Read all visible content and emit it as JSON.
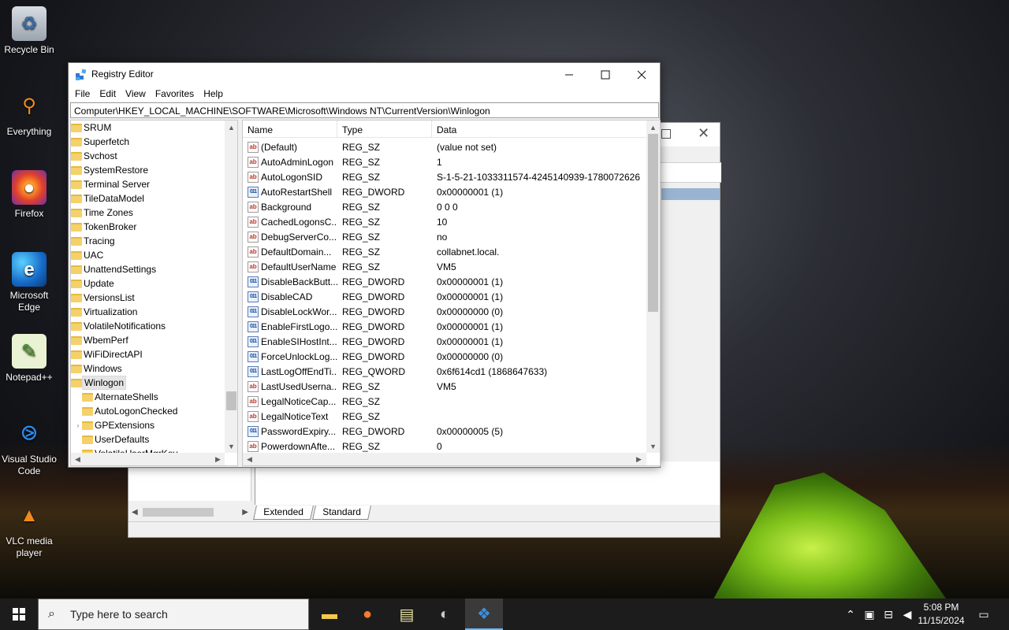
{
  "desktop": {
    "icons": [
      {
        "label": "Recycle Bin",
        "icon": "recycle-bin-icon"
      },
      {
        "label": "Everything",
        "icon": "everything-icon"
      },
      {
        "label": "Firefox",
        "icon": "firefox-icon"
      },
      {
        "label": "Microsoft Edge",
        "icon": "edge-icon"
      },
      {
        "label": "Notepad++",
        "icon": "notepadpp-icon"
      },
      {
        "label": "Visual Studio Code",
        "icon": "vscode-icon"
      },
      {
        "label": "VLC media player",
        "icon": "vlc-icon"
      }
    ]
  },
  "back_window": {
    "tabs": [
      "Extended",
      "Standard"
    ]
  },
  "registry": {
    "title": "Registry Editor",
    "menu": [
      "File",
      "Edit",
      "View",
      "Favorites",
      "Help"
    ],
    "address": "Computer\\HKEY_LOCAL_MACHINE\\SOFTWARE\\Microsoft\\Windows NT\\CurrentVersion\\Winlogon",
    "tree": [
      "SRUM",
      "Superfetch",
      "Svchost",
      "SystemRestore",
      "Terminal Server",
      "TileDataModel",
      "Time Zones",
      "TokenBroker",
      "Tracing",
      "UAC",
      "UnattendSettings",
      "Update",
      "VersionsList",
      "Virtualization",
      "VolatileNotifications",
      "WbemPerf",
      "WiFiDirectAPI",
      "Windows",
      "Winlogon"
    ],
    "tree_children": [
      "AlternateShells",
      "AutoLogonChecked",
      "GPExtensions",
      "UserDefaults",
      "VolatileUserMgrKey"
    ],
    "columns": {
      "name": "Name",
      "type": "Type",
      "data": "Data"
    },
    "values": [
      {
        "name": "(Default)",
        "type": "REG_SZ",
        "data": "(value not set)"
      },
      {
        "name": "AutoAdminLogon",
        "type": "REG_SZ",
        "data": "1"
      },
      {
        "name": "AutoLogonSID",
        "type": "REG_SZ",
        "data": "S-1-5-21-1033311574-4245140939-1780072626"
      },
      {
        "name": "AutoRestartShell",
        "type": "REG_DWORD",
        "data": "0x00000001 (1)"
      },
      {
        "name": "Background",
        "type": "REG_SZ",
        "data": "0 0 0"
      },
      {
        "name": "CachedLogonsC...",
        "type": "REG_SZ",
        "data": "10"
      },
      {
        "name": "DebugServerCo...",
        "type": "REG_SZ",
        "data": "no"
      },
      {
        "name": "DefaultDomain...",
        "type": "REG_SZ",
        "data": "collabnet.local."
      },
      {
        "name": "DefaultUserName",
        "type": "REG_SZ",
        "data": "VM5"
      },
      {
        "name": "DisableBackButt...",
        "type": "REG_DWORD",
        "data": "0x00000001 (1)"
      },
      {
        "name": "DisableCAD",
        "type": "REG_DWORD",
        "data": "0x00000001 (1)"
      },
      {
        "name": "DisableLockWor...",
        "type": "REG_DWORD",
        "data": "0x00000000 (0)"
      },
      {
        "name": "EnableFirstLogo...",
        "type": "REG_DWORD",
        "data": "0x00000001 (1)"
      },
      {
        "name": "EnableSIHostInt...",
        "type": "REG_DWORD",
        "data": "0x00000001 (1)"
      },
      {
        "name": "ForceUnlockLog...",
        "type": "REG_DWORD",
        "data": "0x00000000 (0)"
      },
      {
        "name": "LastLogOffEndTi...",
        "type": "REG_QWORD",
        "data": "0x6f614cd1 (1868647633)"
      },
      {
        "name": "LastUsedUserna...",
        "type": "REG_SZ",
        "data": "VM5"
      },
      {
        "name": "LegalNoticeCap...",
        "type": "REG_SZ",
        "data": ""
      },
      {
        "name": "LegalNoticeText",
        "type": "REG_SZ",
        "data": ""
      },
      {
        "name": "PasswordExpiry...",
        "type": "REG_DWORD",
        "data": "0x00000005 (5)"
      },
      {
        "name": "PowerdownAfte...",
        "type": "REG_SZ",
        "data": "0"
      }
    ]
  },
  "taskbar": {
    "search_placeholder": "Type here to search",
    "time": "5:08 PM",
    "date": "11/15/2024"
  }
}
